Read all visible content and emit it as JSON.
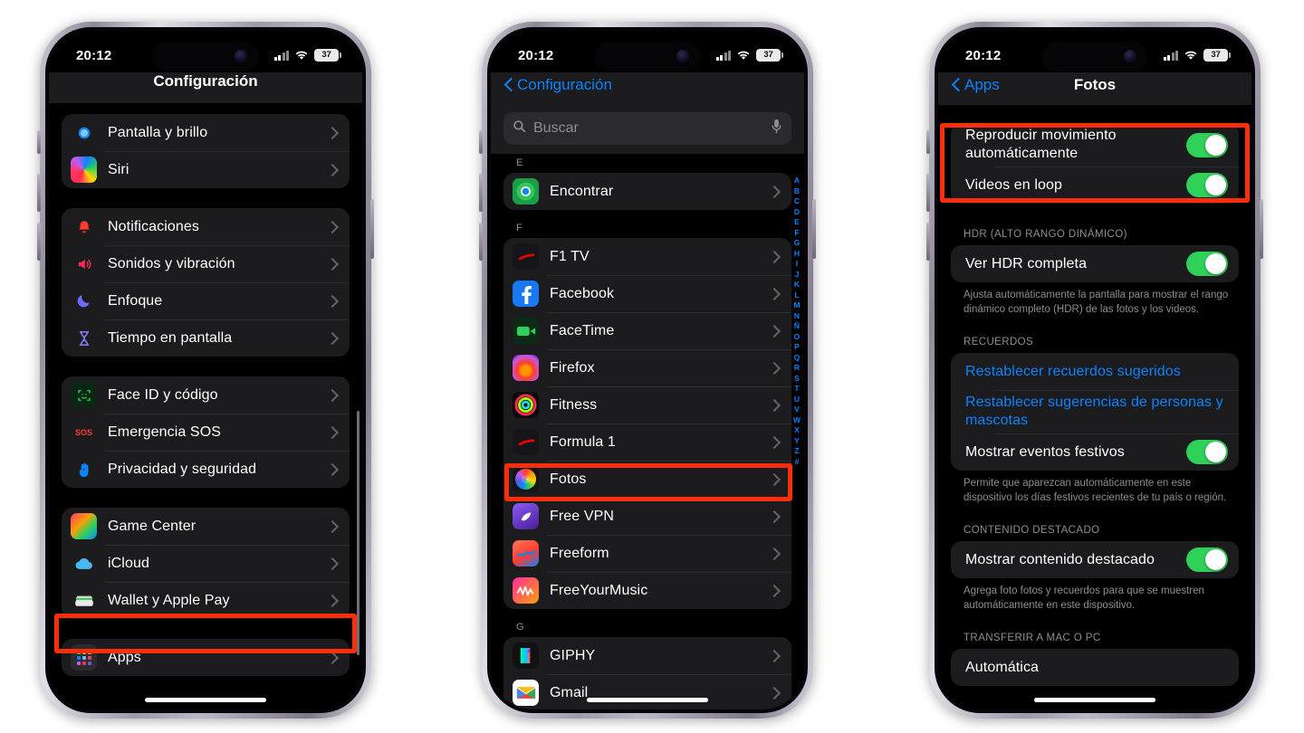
{
  "status_bar": {
    "time": "20:12",
    "battery": "37",
    "wifi_icon": "wifi-icon",
    "cellular_icon": "cellular-signal-icon"
  },
  "phone1": {
    "nav_title": "Configuración",
    "groups": [
      {
        "rows": [
          {
            "label": "Pantalla y brillo",
            "icon": "brightness-icon"
          },
          {
            "label": "Siri",
            "icon": "siri-icon"
          }
        ]
      },
      {
        "rows": [
          {
            "label": "Notificaciones",
            "icon": "notifications-bell-icon"
          },
          {
            "label": "Sonidos y vibración",
            "icon": "sound-speaker-icon"
          },
          {
            "label": "Enfoque",
            "icon": "focus-moon-icon"
          },
          {
            "label": "Tiempo en pantalla",
            "icon": "screen-time-hourglass-icon"
          }
        ]
      },
      {
        "rows": [
          {
            "label": "Face ID y código",
            "icon": "face-id-icon"
          },
          {
            "label": "Emergencia SOS",
            "icon": "sos-icon"
          },
          {
            "label": "Privacidad y seguridad",
            "icon": "privacy-hand-icon"
          }
        ]
      },
      {
        "rows": [
          {
            "label": "Game Center",
            "icon": "game-center-icon"
          },
          {
            "label": "iCloud",
            "icon": "icloud-icon"
          },
          {
            "label": "Wallet y Apple Pay",
            "icon": "wallet-icon"
          }
        ]
      },
      {
        "rows": [
          {
            "label": "Apps",
            "icon": "apps-grid-icon",
            "highlighted": true
          }
        ]
      }
    ]
  },
  "phone2": {
    "back_label": "Configuración",
    "search": {
      "placeholder": "Buscar",
      "search_icon": "search-icon",
      "mic_icon": "microphone-icon"
    },
    "sections": [
      {
        "letter": "E",
        "rows": [
          {
            "label": "Encontrar",
            "icon": "find-my-icon"
          }
        ]
      },
      {
        "letter": "F",
        "rows": [
          {
            "label": "F1 TV",
            "icon": "f1-tv-icon"
          },
          {
            "label": "Facebook",
            "icon": "facebook-icon"
          },
          {
            "label": "FaceTime",
            "icon": "facetime-icon"
          },
          {
            "label": "Firefox",
            "icon": "firefox-icon"
          },
          {
            "label": "Fitness",
            "icon": "fitness-icon"
          },
          {
            "label": "Formula 1",
            "icon": "formula-1-icon"
          },
          {
            "label": "Fotos",
            "icon": "photos-icon",
            "highlighted": true
          },
          {
            "label": "Free VPN",
            "icon": "free-vpn-icon"
          },
          {
            "label": "Freeform",
            "icon": "freeform-icon"
          },
          {
            "label": "FreeYourMusic",
            "icon": "freeyourmusic-icon"
          }
        ]
      },
      {
        "letter": "G",
        "rows": [
          {
            "label": "GIPHY",
            "icon": "giphy-icon"
          },
          {
            "label": "Gmail",
            "icon": "gmail-icon"
          }
        ]
      }
    ],
    "alpha_index": [
      "A",
      "B",
      "C",
      "D",
      "E",
      "F",
      "G",
      "H",
      "I",
      "J",
      "K",
      "L",
      "M",
      "N",
      "Ñ",
      "O",
      "P",
      "Q",
      "R",
      "S",
      "T",
      "U",
      "V",
      "W",
      "X",
      "Y",
      "Z",
      "#"
    ]
  },
  "phone3": {
    "back_label": "Apps",
    "nav_title": "Fotos",
    "sections": [
      {
        "header": "",
        "highlighted": true,
        "rows": [
          {
            "label": "Reproducir movimiento automáticamente",
            "control": "toggle",
            "on": true
          },
          {
            "label": "Videos en loop",
            "control": "toggle",
            "on": true
          }
        ]
      },
      {
        "header": "HDR (ALTO RANGO DINÁMICO)",
        "rows": [
          {
            "label": "Ver HDR completa",
            "control": "toggle",
            "on": true
          }
        ],
        "footnote": "Ajusta automáticamente la pantalla para mostrar el rango dinámico completo (HDR) de las fotos y los videos."
      },
      {
        "header": "RECUERDOS",
        "rows": [
          {
            "label": "Restablecer recuerdos sugeridos",
            "control": "link"
          },
          {
            "label": "Restablecer sugerencias de personas y mascotas",
            "control": "link"
          },
          {
            "label": "Mostrar eventos festivos",
            "control": "toggle",
            "on": true
          }
        ],
        "footnote": "Permite que aparezcan automáticamente en este dispositivo los días festivos recientes de tu país o región."
      },
      {
        "header": "CONTENIDO DESTACADO",
        "rows": [
          {
            "label": "Mostrar contenido destacado",
            "control": "toggle",
            "on": true
          }
        ],
        "footnote": "Agrega foto fotos y recuerdos para que se muestren automáticamente en este dispositivo."
      },
      {
        "header": "TRANSFERIR A MAC O PC",
        "rows": [
          {
            "label": "Automática",
            "control": "value"
          }
        ]
      }
    ]
  },
  "colors": {
    "highlight_red": "#fb2e0c",
    "accent_blue": "#0a84ff",
    "toggle_green": "#30d158",
    "list_bg": "#1c1c1e",
    "screen_bg": "#000000"
  }
}
